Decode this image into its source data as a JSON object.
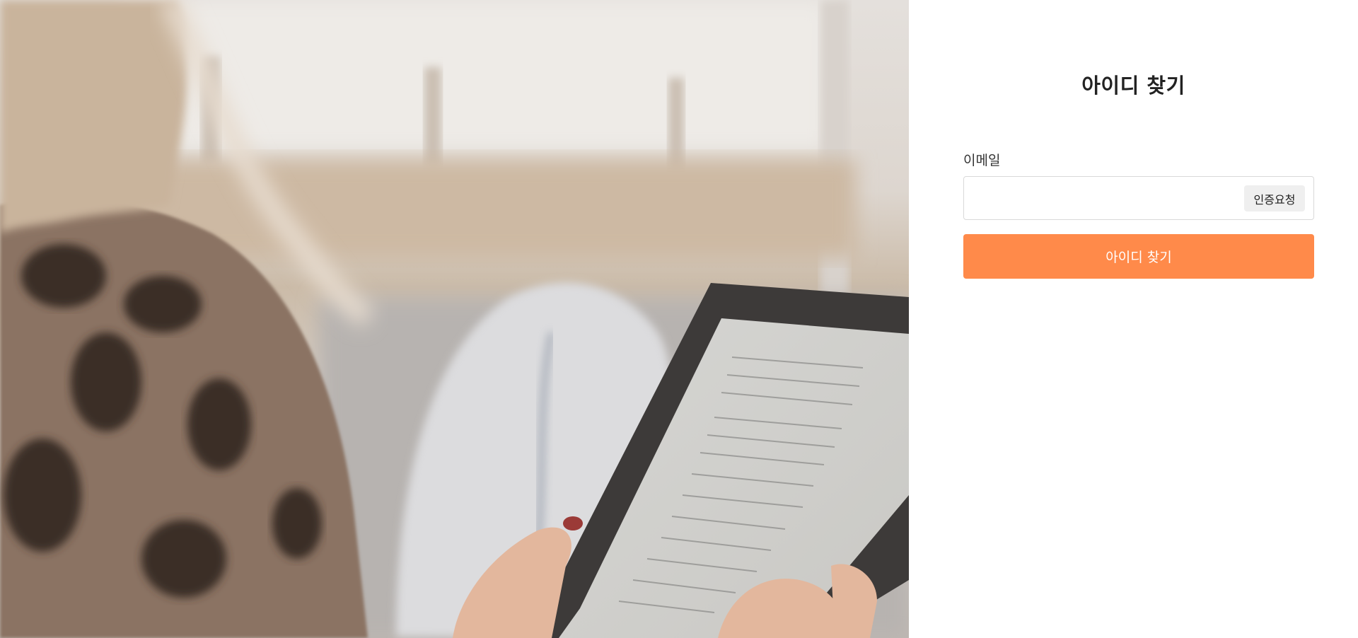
{
  "hero": {
    "image_icon": "person-reading-tablet-photo"
  },
  "form": {
    "title": "아이디 찾기",
    "email_label": "이메일",
    "email_value": "",
    "email_placeholder": "",
    "verify_button_label": "인증요청",
    "submit_button_label": "아이디 찾기"
  },
  "colors": {
    "accent": "#ff8a4a",
    "verify_button_bg": "#efefef",
    "input_border": "#d9d9d9"
  }
}
